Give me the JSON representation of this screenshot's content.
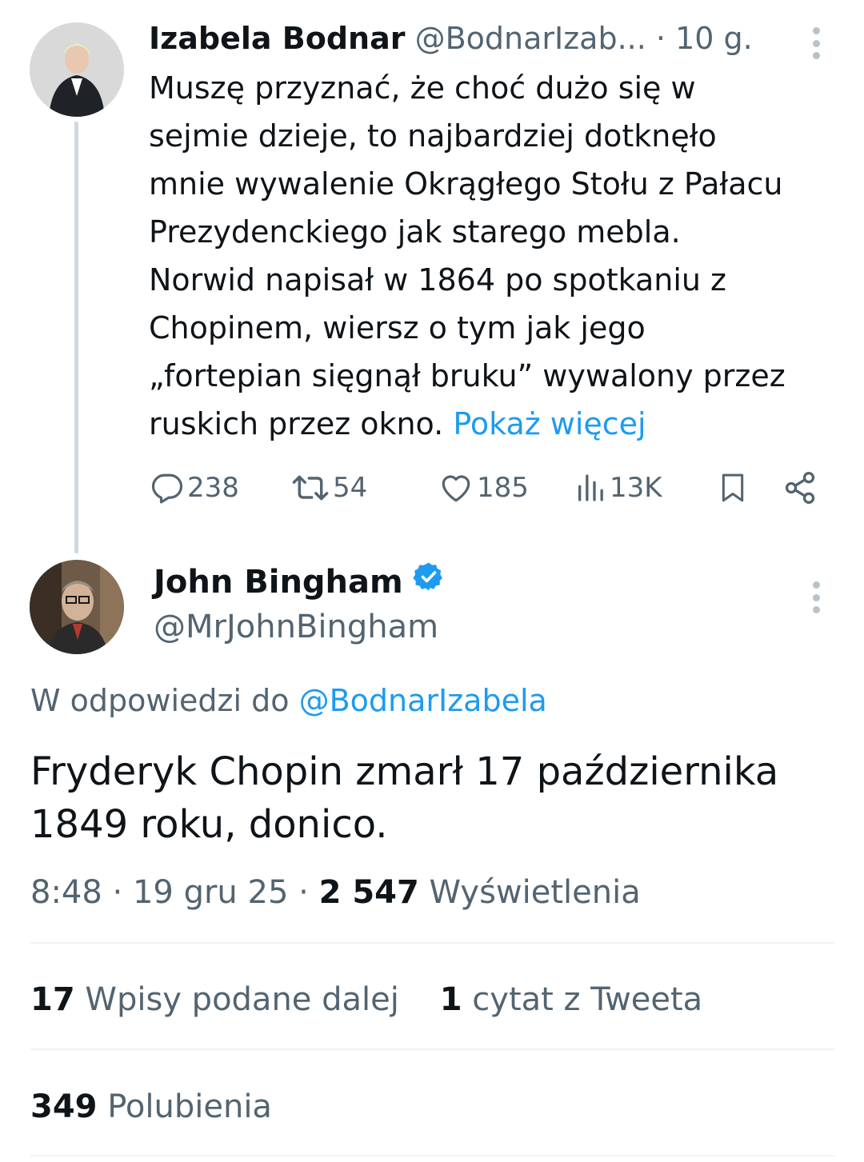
{
  "reply_parent": {
    "author_name": "Izabela Bodnar",
    "author_handle": "@BodnarIzab...",
    "separator": "·",
    "time_ago": "10 g.",
    "text_lines": [
      "Muszę przyznać, że choć dużo się w",
      "sejmie dzieje, to najbardziej dotknęło",
      "mnie wywalenie Okrągłego Stołu z Pałacu",
      "Prezydenckiego jak starego mebla.",
      "Norwid napisał w 1864 po spotkaniu z",
      "Chopinem, wiersz o tym jak jego",
      "„fortepian sięgnął bruku” wywalony przez",
      "ruskich przez okno."
    ],
    "show_more": "Pokaż więcej",
    "actions": {
      "replies": "238",
      "reposts": "54",
      "likes": "185",
      "views": "13K"
    },
    "icons": [
      "reply-icon",
      "repost-icon",
      "like-icon",
      "views-icon",
      "bookmark-icon",
      "share-icon",
      "more-icon"
    ]
  },
  "main_tweet": {
    "author_name": "John Bingham",
    "author_handle": "@MrJohnBingham",
    "verified": true,
    "reply_to_prefix": "W odpowiedzi do",
    "reply_to_handle": "@BodnarIzabela",
    "text_lines": [
      "Fryderyk Chopin zmarł 17 października",
      "1849 roku, donico."
    ],
    "time": "8:48",
    "dot": "·",
    "date": "19 gru 25",
    "views_count": "2 547",
    "views_label": "Wyświetlenia",
    "reposts_count": "17",
    "reposts_label": "Wpisy podane dalej",
    "quotes_count": "1",
    "quotes_label": "cytat z Tweeta",
    "likes_count": "349",
    "likes_label": "Polubienia"
  },
  "colors": {
    "text": "#0f1419",
    "secondary": "#536471",
    "link": "#1d9bf0",
    "divider": "#eff3f4",
    "thread_line": "#cfd9de",
    "verified": "#1d9bf0"
  }
}
